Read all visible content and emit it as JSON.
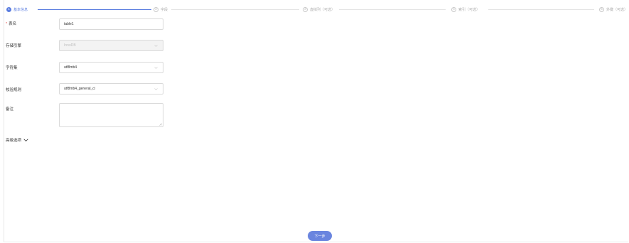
{
  "steps": [
    {
      "num": "1",
      "label": "基本信息"
    },
    {
      "num": "2",
      "label": "字段"
    },
    {
      "num": "3",
      "label": "虚拟列（可选）"
    },
    {
      "num": "4",
      "label": "索引（可选）"
    },
    {
      "num": "5",
      "label": "外键（可选）"
    }
  ],
  "form": {
    "table_name": {
      "required_mark": "*",
      "label": "表名",
      "value": "table1"
    },
    "engine": {
      "label": "存储引擎",
      "value": "InnoDB"
    },
    "charset": {
      "label": "字符集",
      "value": "utf8mb4"
    },
    "collation": {
      "label": "校验规则",
      "value": "utf8mb4_general_ci"
    },
    "comment": {
      "label": "备注",
      "value": ""
    }
  },
  "advanced": {
    "label": "高级选项"
  },
  "footer": {
    "next_label": "下一步"
  },
  "colors": {
    "accent": "#5b7de0",
    "button": "#6a85df",
    "required": "#e4504a"
  },
  "icons": [
    "chevron-down-icon",
    "resize-grip-icon"
  ]
}
